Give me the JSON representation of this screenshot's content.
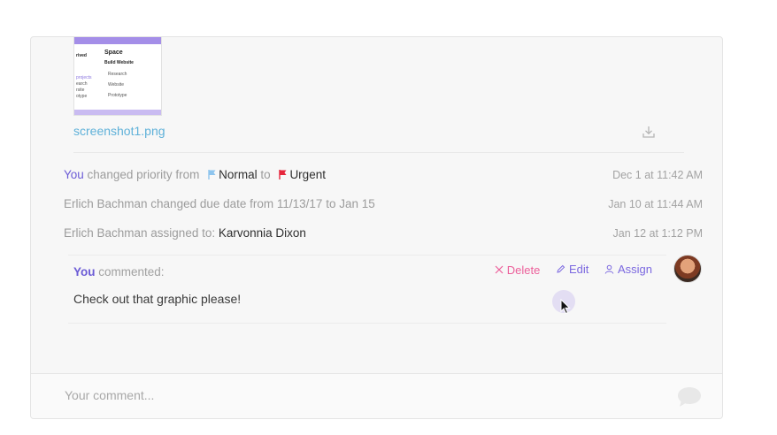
{
  "attachment": {
    "filename": "screenshot1.png",
    "thumbnail": {
      "heading": "Space",
      "subheading": "Build Website",
      "items": [
        "Research",
        "Website",
        "Prototype"
      ],
      "left_fragments": [
        "rived",
        "projects",
        "earch",
        "rsite",
        "otype"
      ]
    },
    "download_icon": "download-icon"
  },
  "activity": [
    {
      "you": "You",
      "text1": "changed priority from",
      "from_value": "Normal",
      "text2": "to",
      "to_value": "Urgent",
      "timestamp": "Dec 1 at 11:42 AM",
      "from_flag_color": "#8ec5ee",
      "to_flag_color": "#e6263c"
    },
    {
      "text": "Erlich Bachman changed due date from 11/13/17 to Jan 15",
      "timestamp": "Jan 10 at 11:44 AM"
    },
    {
      "text": "Erlich Bachman assigned to:",
      "value": "Karvonnia Dixon",
      "timestamp": "Jan 12 at 1:12 PM"
    }
  ],
  "comment": {
    "author": "You",
    "verb": "commented:",
    "body": "Check out that graphic please!",
    "actions": {
      "delete": "Delete",
      "edit": "Edit",
      "assign": "Assign"
    }
  },
  "composer": {
    "placeholder": "Your comment..."
  },
  "colors": {
    "accent": "#7b68e0",
    "delete": "#ec5f9a",
    "link": "#5fb1d9"
  }
}
